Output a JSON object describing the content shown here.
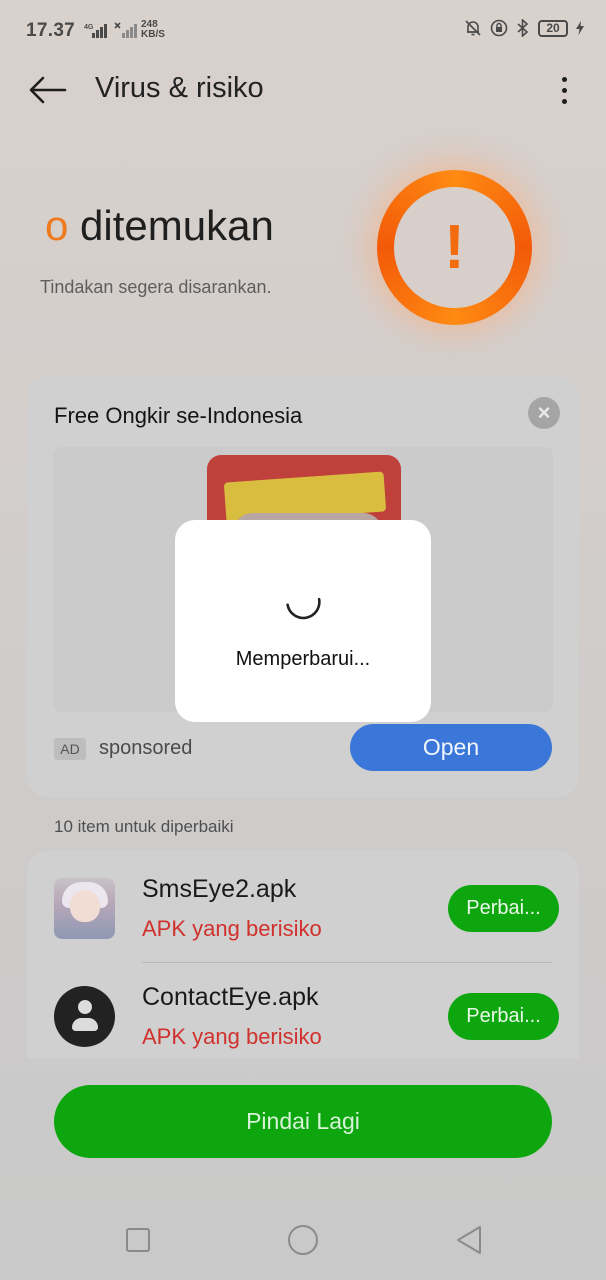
{
  "status_bar": {
    "time": "17.37",
    "net_speed_value": "248",
    "net_speed_unit": "KB/S",
    "battery": "20"
  },
  "header": {
    "title": "Virus & risiko"
  },
  "summary": {
    "count": "o",
    "headline": " ditemukan",
    "subtitle": "Tindakan segera disarankan.",
    "warning_icon": "exclamation-icon",
    "accent_color": "#f26c0e"
  },
  "ad": {
    "title": "Free Ongkir se-Indonesia",
    "badge": "AD",
    "sponsored": "sponsored",
    "open_label": "Open",
    "open_color": "#3a77d8"
  },
  "loading": {
    "text": "Memperbarui..."
  },
  "items": {
    "label": "10 item untuk diperbaiki",
    "rows": [
      {
        "name": "SmsEye2.apk",
        "risk": "APK yang berisiko",
        "fix_label": "Perbai..."
      },
      {
        "name": "ContactEye.apk",
        "risk": "APK yang berisiko",
        "fix_label": "Perbai..."
      }
    ],
    "risk_color": "#d0312d"
  },
  "actions": {
    "rescan_label": "Pindai Lagi",
    "button_color": "#0ea60f"
  }
}
